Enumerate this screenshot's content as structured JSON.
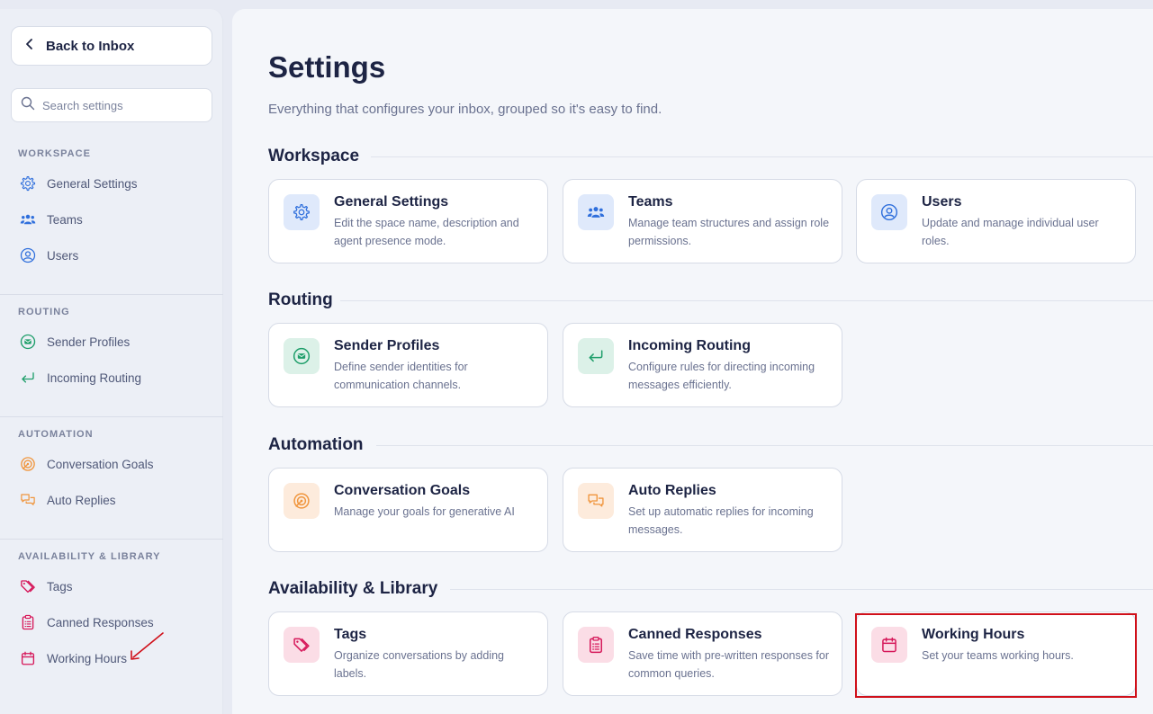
{
  "sidebar": {
    "back_label": "Back to Inbox",
    "search_placeholder": "Search settings",
    "sections": [
      {
        "title": "WORKSPACE",
        "items": [
          {
            "label": "General Settings",
            "icon": "gear-icon"
          },
          {
            "label": "Teams",
            "icon": "teams-icon"
          },
          {
            "label": "Users",
            "icon": "user-circle-icon"
          }
        ]
      },
      {
        "title": "ROUTING",
        "items": [
          {
            "label": "Sender Profiles",
            "icon": "mail-circle-icon"
          },
          {
            "label": "Incoming Routing",
            "icon": "enter-arrow-icon"
          }
        ]
      },
      {
        "title": "AUTOMATION",
        "items": [
          {
            "label": "Conversation Goals",
            "icon": "target-icon"
          },
          {
            "label": "Auto Replies",
            "icon": "chat-bubbles-icon"
          }
        ]
      },
      {
        "title": "AVAILABILITY & LIBRARY",
        "items": [
          {
            "label": "Tags",
            "icon": "tag-icon"
          },
          {
            "label": "Canned Responses",
            "icon": "clipboard-icon"
          },
          {
            "label": "Working Hours",
            "icon": "calendar-icon"
          }
        ]
      }
    ]
  },
  "main": {
    "title": "Settings",
    "subtitle": "Everything that configures your inbox, grouped so it's easy to find.",
    "groups": [
      {
        "title": "Workspace",
        "cards": [
          {
            "title": "General Settings",
            "desc": "Edit the space name, description and agent presence mode.",
            "icon": "gear-icon"
          },
          {
            "title": "Teams",
            "desc": "Manage team structures and assign role permissions.",
            "icon": "teams-icon"
          },
          {
            "title": "Users",
            "desc": "Update and manage individual user roles.",
            "icon": "user-circle-icon"
          }
        ]
      },
      {
        "title": "Routing",
        "cards": [
          {
            "title": "Sender Profiles",
            "desc": "Define sender identities for communication channels.",
            "icon": "mail-circle-icon"
          },
          {
            "title": "Incoming Routing",
            "desc": "Configure rules for directing incoming messages efficiently.",
            "icon": "enter-arrow-icon"
          }
        ]
      },
      {
        "title": "Automation",
        "cards": [
          {
            "title": "Conversation Goals",
            "desc": "Manage your goals for generative AI",
            "icon": "target-icon"
          },
          {
            "title": "Auto Replies",
            "desc": "Set up automatic replies for incoming messages.",
            "icon": "chat-bubbles-icon"
          }
        ]
      },
      {
        "title": "Availability & Library",
        "cards": [
          {
            "title": "Tags",
            "desc": "Organize conversations by adding labels.",
            "icon": "tag-icon"
          },
          {
            "title": "Canned Responses",
            "desc": "Save time with pre-written responses for common queries.",
            "icon": "clipboard-icon"
          },
          {
            "title": "Working Hours",
            "desc": "Set your teams working hours.",
            "icon": "calendar-icon"
          }
        ]
      }
    ]
  },
  "colors": {
    "blue_icon": "#2f6fdc",
    "green_icon": "#1e9e6a",
    "orange_icon": "#f0953c",
    "pink_icon": "#d6185a",
    "highlight": "#d0101a"
  }
}
